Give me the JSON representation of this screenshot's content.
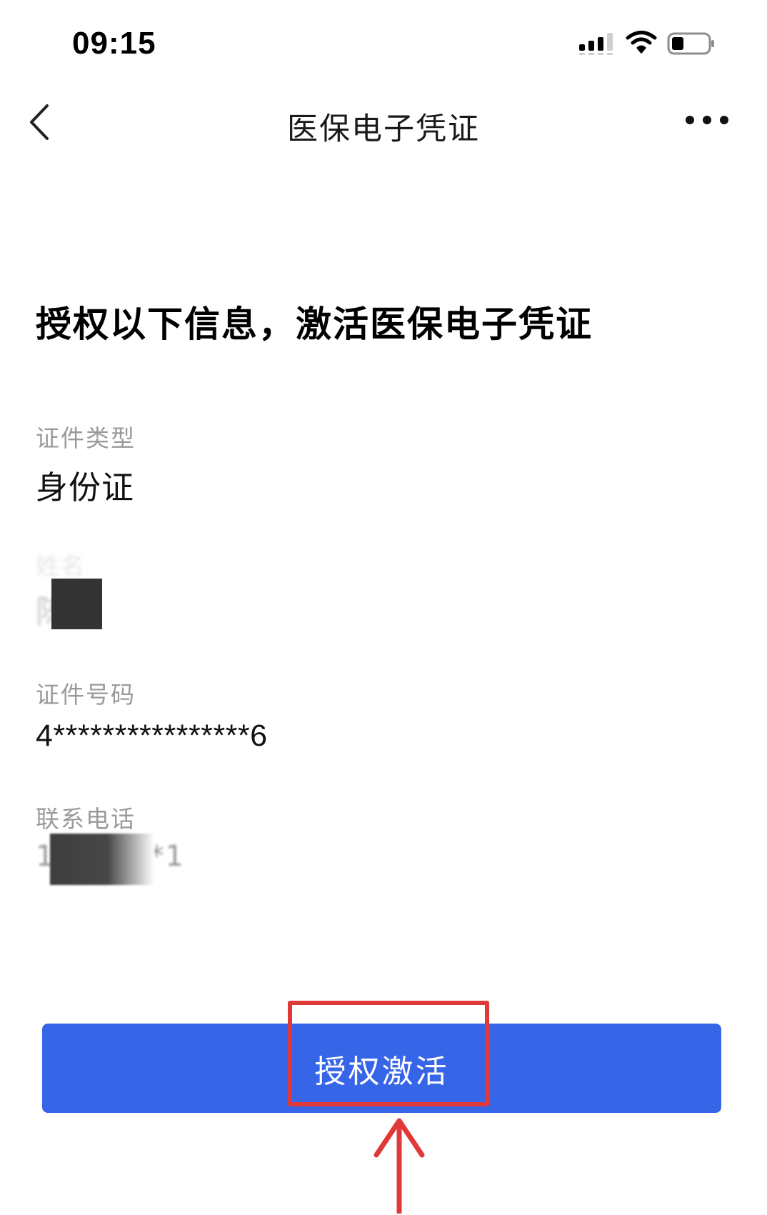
{
  "status_bar": {
    "time": "09:15"
  },
  "nav": {
    "title": "医保电子凭证"
  },
  "heading": "授权以下信息，激活医保电子凭证",
  "fields": {
    "id_type": {
      "label": "证件类型",
      "value": "身份证"
    },
    "name": {
      "label": "姓名",
      "value": "陈"
    },
    "id_number": {
      "label": "证件号码",
      "value": "4****************6"
    },
    "phone": {
      "label": "联系电话",
      "value": "1*******1"
    }
  },
  "actions": {
    "activate_label": "授权激活"
  },
  "colors": {
    "primary": "#3765e8",
    "annotation": "#e0393a",
    "label_gray": "#9a9a9a"
  },
  "icons": {
    "back": "chevron-left-icon",
    "more": "more-horizontal-icon",
    "signal": "cellular-signal-icon",
    "wifi": "wifi-icon",
    "battery": "battery-icon"
  }
}
